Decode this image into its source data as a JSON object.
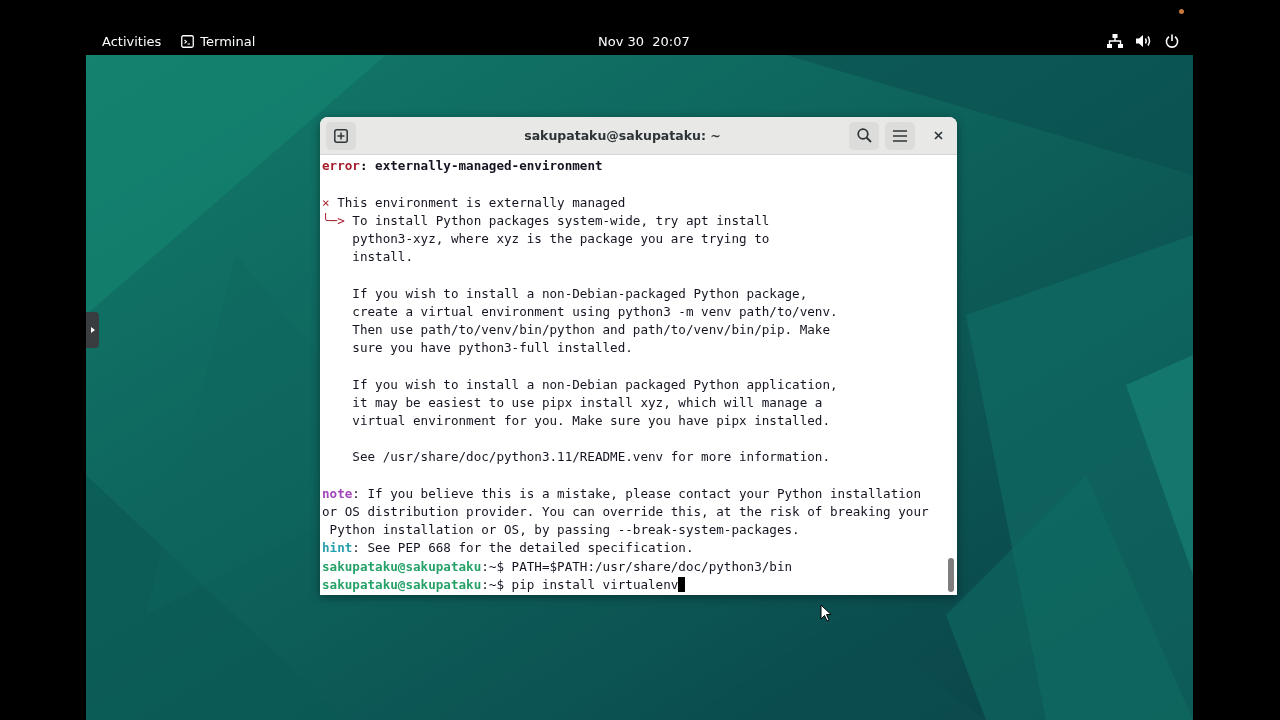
{
  "top_bar": {
    "activities": "Activities",
    "app_name": "Terminal",
    "clock": "Nov 30  20:07"
  },
  "terminal": {
    "title": "sakupataku@sakupataku: ~",
    "lines": [
      {
        "segments": [
          {
            "kind": "error",
            "text": "error"
          },
          {
            "kind": "bold",
            "text": ": externally-managed-environment"
          }
        ]
      },
      {
        "blank_before": true,
        "segments": [
          {
            "kind": "marker",
            "text": "×"
          },
          {
            "kind": "plain",
            "text": " This environment is externally managed"
          }
        ]
      },
      {
        "segments": [
          {
            "kind": "marker",
            "text": "╰─>"
          },
          {
            "kind": "plain",
            "text": " To install Python packages system-wide, try apt install"
          }
        ]
      },
      {
        "segments": [
          {
            "kind": "plain",
            "text": "    python3-xyz, where xyz is the package you are trying to"
          }
        ]
      },
      {
        "segments": [
          {
            "kind": "plain",
            "text": "    install."
          }
        ]
      },
      {
        "blank_before": true,
        "segments": [
          {
            "kind": "plain",
            "text": "    If you wish to install a non-Debian-packaged Python package,"
          }
        ]
      },
      {
        "segments": [
          {
            "kind": "plain",
            "text": "    create a virtual environment using python3 -m venv path/to/venv."
          }
        ]
      },
      {
        "segments": [
          {
            "kind": "plain",
            "text": "    Then use path/to/venv/bin/python and path/to/venv/bin/pip. Make"
          }
        ]
      },
      {
        "segments": [
          {
            "kind": "plain",
            "text": "    sure you have python3-full installed."
          }
        ]
      },
      {
        "blank_before": true,
        "segments": [
          {
            "kind": "plain",
            "text": "    If you wish to install a non-Debian packaged Python application,"
          }
        ]
      },
      {
        "segments": [
          {
            "kind": "plain",
            "text": "    it may be easiest to use pipx install xyz, which will manage a"
          }
        ]
      },
      {
        "segments": [
          {
            "kind": "plain",
            "text": "    virtual environment for you. Make sure you have pipx installed."
          }
        ]
      },
      {
        "blank_before": true,
        "segments": [
          {
            "kind": "plain",
            "text": "    See /usr/share/doc/python3.11/README.venv for more information."
          }
        ]
      },
      {
        "blank_before": true,
        "segments": [
          {
            "kind": "note",
            "text": "note"
          },
          {
            "kind": "plain",
            "text": ": If you believe this is a mistake, please contact your Python installation"
          }
        ]
      },
      {
        "segments": [
          {
            "kind": "plain",
            "text": "or OS distribution provider. You can override this, at the risk of breaking your"
          }
        ]
      },
      {
        "segments": [
          {
            "kind": "plain",
            "text": " Python installation or OS, by passing --break-system-packages."
          }
        ]
      },
      {
        "segments": [
          {
            "kind": "hint",
            "text": "hint"
          },
          {
            "kind": "plain",
            "text": ": See PEP 668 for the detailed specification."
          }
        ]
      },
      {
        "segments": [
          {
            "kind": "user",
            "text": "sakupataku@sakupataku"
          },
          {
            "kind": "plain",
            "text": ":~$ PATH=$PATH:/usr/share/doc/python3/bin"
          }
        ]
      },
      {
        "cursor": true,
        "segments": [
          {
            "kind": "user",
            "text": "sakupataku@sakupataku"
          },
          {
            "kind": "plain",
            "text": ":~$ pip install virtualenv"
          }
        ]
      }
    ]
  }
}
